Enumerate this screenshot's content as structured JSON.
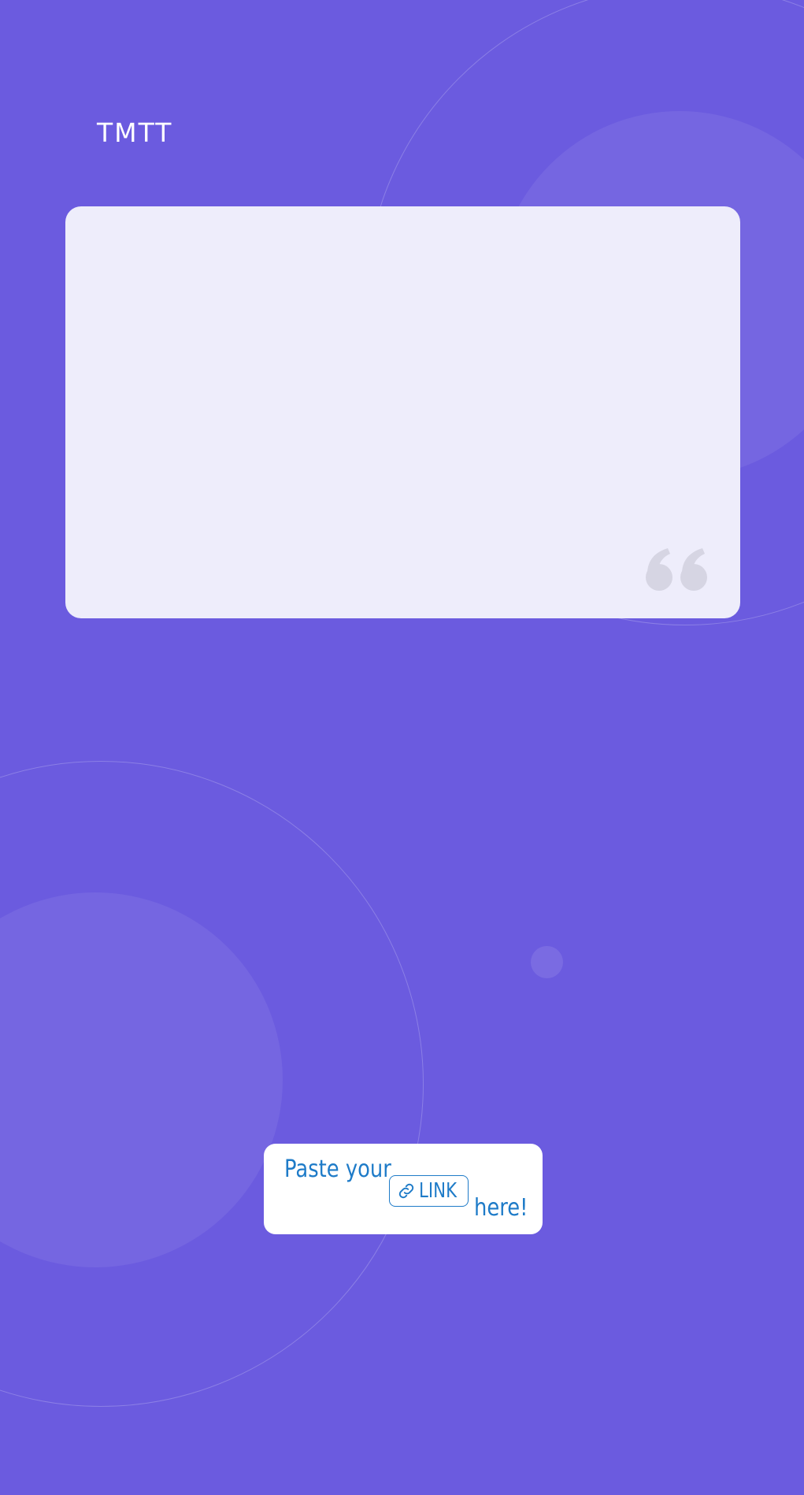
{
  "app": {
    "brand": "TMTT"
  },
  "quote_card": {
    "text": "",
    "icon": "quote-marks-icon"
  },
  "link_sticker": {
    "prefix": "Paste your",
    "link_label": "LINK",
    "suffix": "here!",
    "icon": "link-chain-icon"
  },
  "colors": {
    "background": "#6B5BDF",
    "card": "#EEEDFB",
    "quote_icon": "#D6D5E3",
    "sticker_background": "#FFFFFF",
    "sticker_text": "#1E7BC8"
  }
}
